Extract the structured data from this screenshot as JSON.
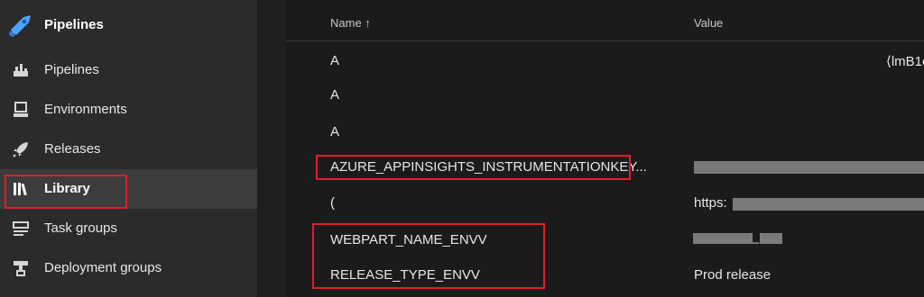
{
  "sidebar": {
    "title": "Pipelines",
    "items": [
      {
        "label": "Pipelines",
        "icon": "pipelines-icon"
      },
      {
        "label": "Environments",
        "icon": "environments-icon"
      },
      {
        "label": "Releases",
        "icon": "releases-icon"
      },
      {
        "label": "Library",
        "icon": "library-icon",
        "selected": true
      },
      {
        "label": "Task groups",
        "icon": "task-groups-icon"
      },
      {
        "label": "Deployment groups",
        "icon": "deployment-groups-icon"
      }
    ]
  },
  "table": {
    "columns": {
      "name": "Name ↑",
      "value": "Value"
    },
    "rows": [
      {
        "name": "A",
        "value": "⟨lmB1c"
      },
      {
        "name": "A",
        "value": ""
      },
      {
        "name": "A",
        "value": ""
      },
      {
        "name": "AZURE_APPINSIGHTS_INSTRUMENTATIONKEY...",
        "value": ""
      },
      {
        "name": "(",
        "value": "https:"
      },
      {
        "name": "WEBPART_NAME_ENVV",
        "value": "_"
      },
      {
        "name": "RELEASE_TYPE_ENVV",
        "value": "Prod release"
      }
    ]
  },
  "colors": {
    "accent": "#e01f26",
    "sidebar_bg": "#2b2b2b",
    "selected_bg": "#3c3c3c"
  }
}
